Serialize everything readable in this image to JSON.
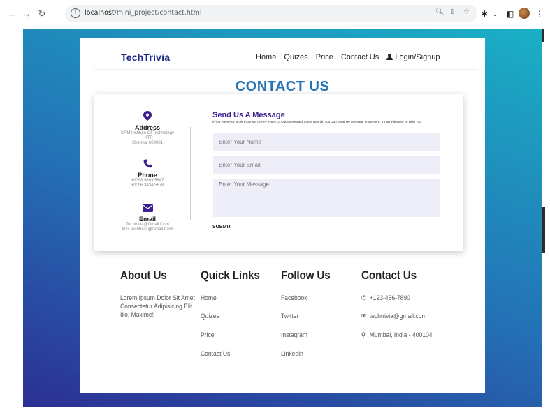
{
  "browser": {
    "url_host": "localhost",
    "url_path": "/mini_project/contact.html"
  },
  "site": {
    "brand": "TechTrivia",
    "nav": [
      "Home",
      "Quizes",
      "Price",
      "Contact Us"
    ],
    "login": "Login/Signup"
  },
  "contact": {
    "title": "CONTACT US",
    "address": {
      "title": "Address",
      "lines": [
        "SRM Institute Of Technology",
        ", KTR",
        "Chennai 600001"
      ]
    },
    "phone": {
      "title": "Phone",
      "lines": [
        "+0098 9893 5647",
        "+0096 3434 5678"
      ]
    },
    "email": {
      "title": "Email",
      "lines": [
        "Techtrivia@Gmail.Com",
        "Info.Techtrivia@Gmail.Com"
      ]
    },
    "form": {
      "title": "Send Us A Message",
      "subtitle": "If You Have Any Work From Me Or Any Types Of Quizes Related To My Tutorial, You Can Send Me Message From Here. It's My Pleasure To Help You.",
      "name_placeholder": "Enter Your Name",
      "email_placeholder": "Enter Your Email",
      "message_placeholder": "Enter Your Message",
      "submit": "SUBMIT"
    }
  },
  "footer": {
    "about": {
      "title": "About Us",
      "lines": [
        "Lorem Ipsum Dolor Sit Amet",
        "Consectetur Adipisicing Elit.",
        "Illo, Maxime!"
      ]
    },
    "quick_links": {
      "title": "Quick Links",
      "items": [
        "Home",
        "Quizes",
        "Price",
        "Contact Us"
      ]
    },
    "follow": {
      "title": "Follow Us",
      "items": [
        "Facebook",
        "Twitter",
        "Instagram",
        "Linkedin"
      ]
    },
    "contact": {
      "title": "Contact Us",
      "phone": "+123-456-7890",
      "email": "techtrivia@gmail.com",
      "address": "Mumbai, India - 400104"
    }
  },
  "colors": {
    "brand": "#1b2a8a",
    "title": "#2574b8",
    "icon": "#3b1e8f",
    "field_bg": "#eeeef8"
  }
}
